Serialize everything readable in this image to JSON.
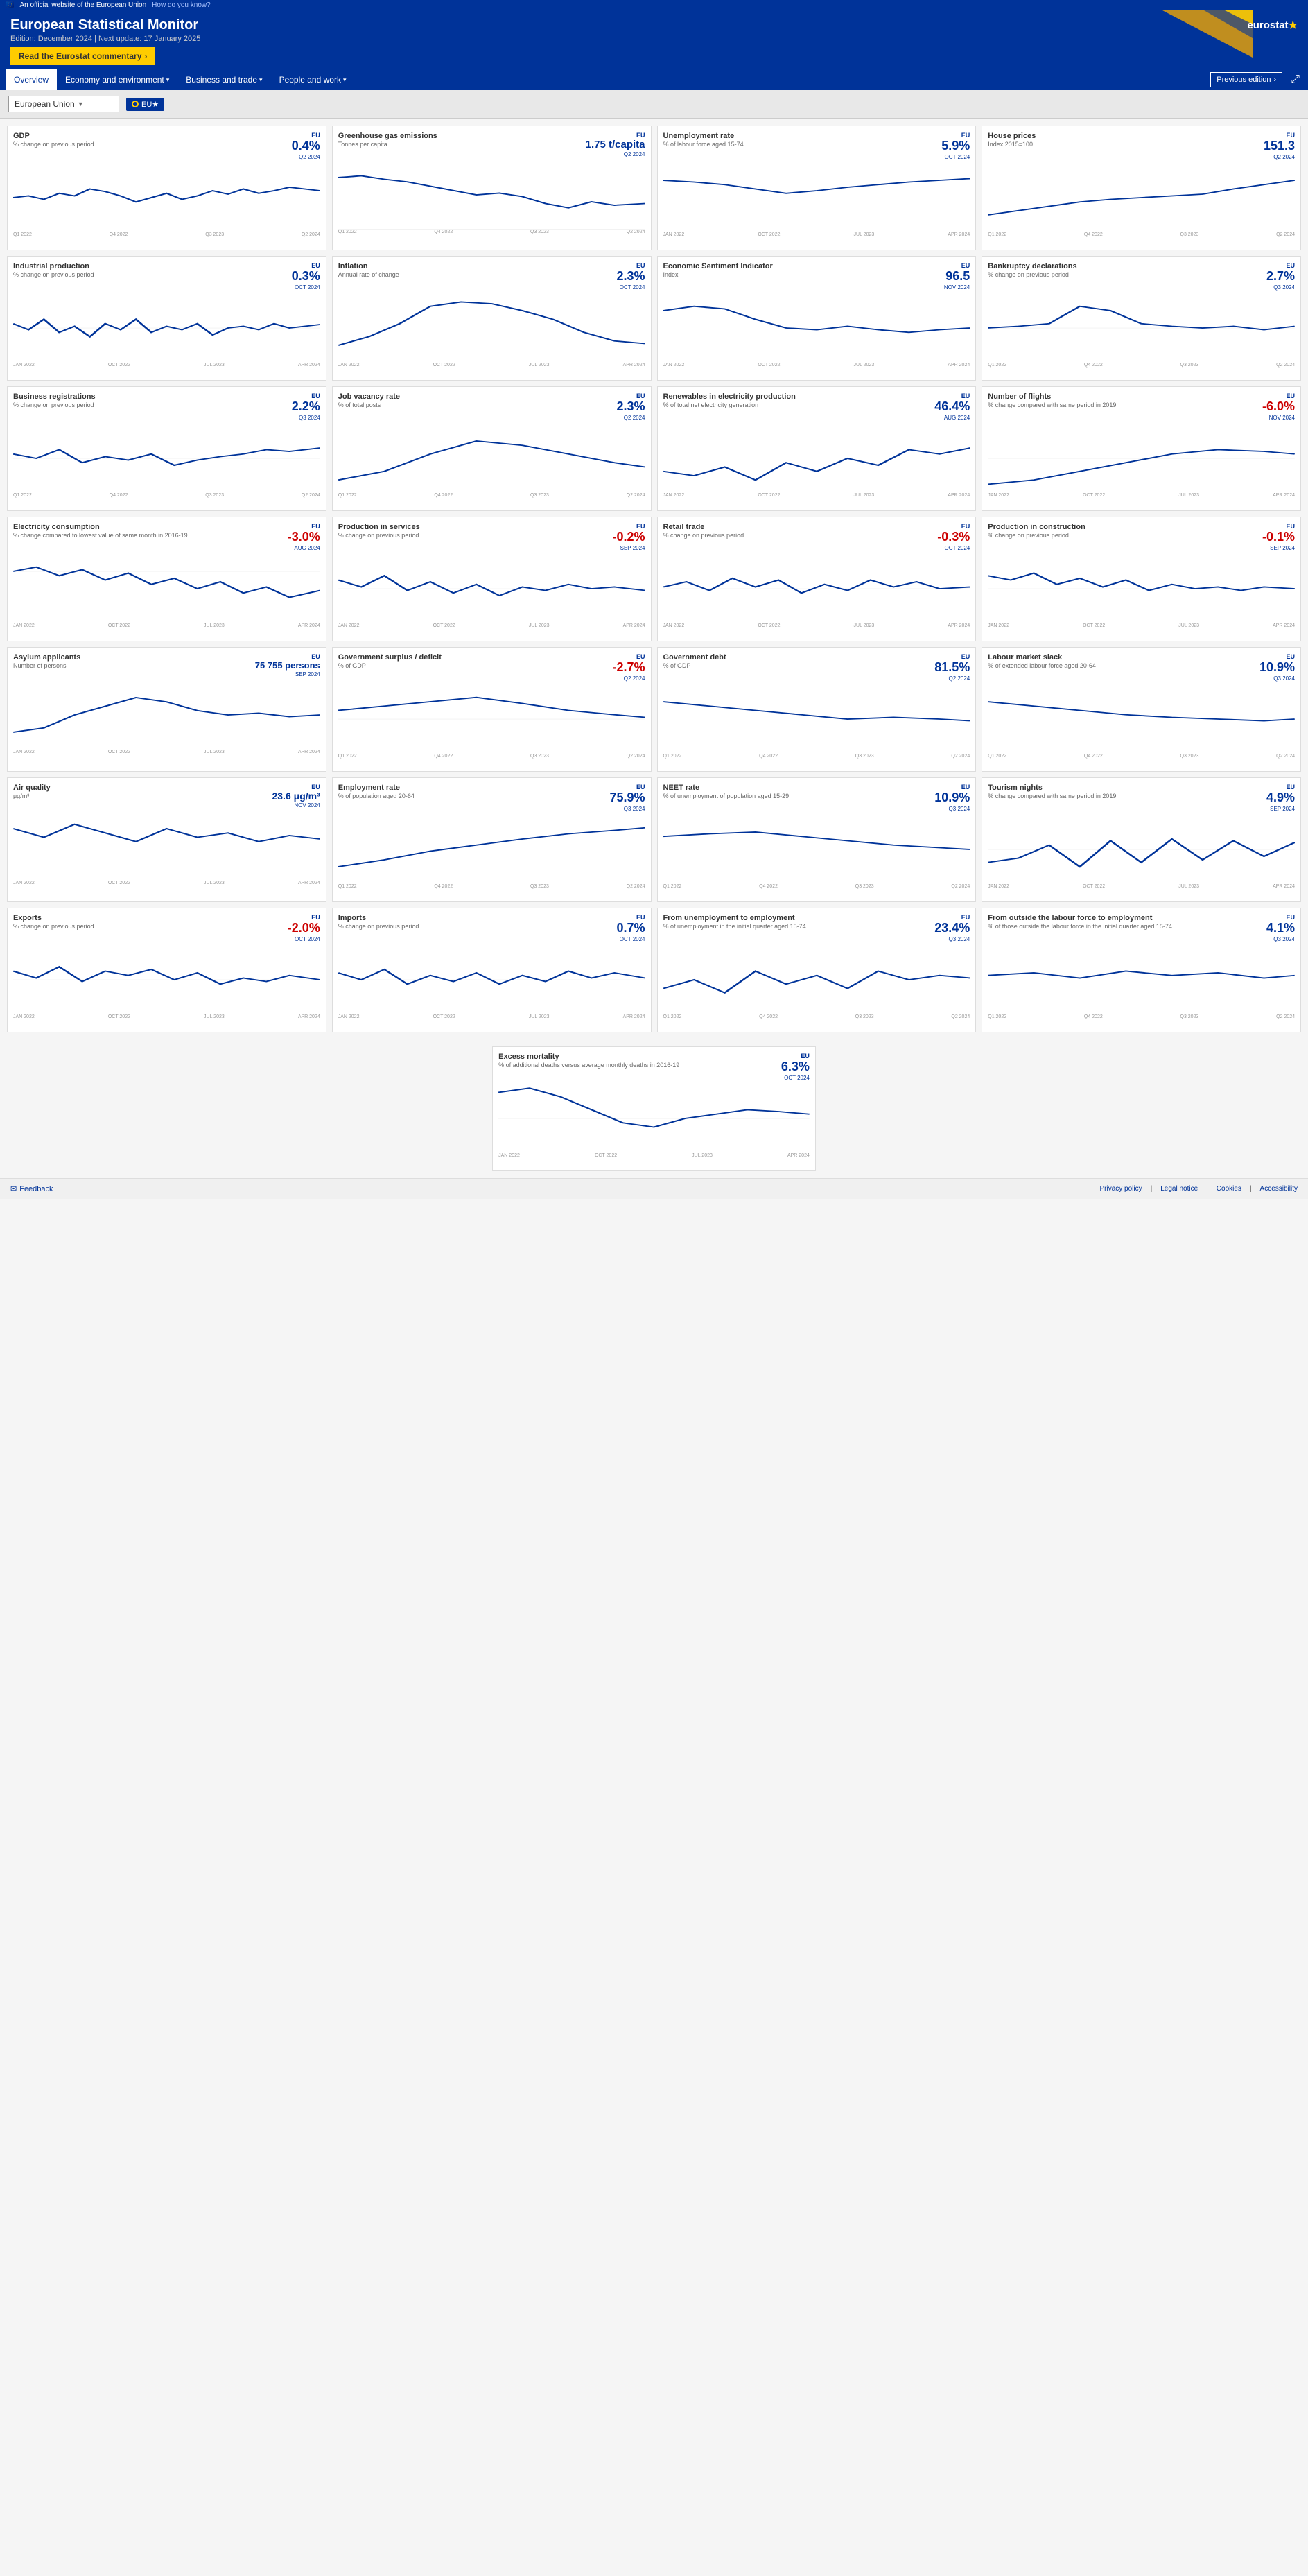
{
  "topbar": {
    "official_text": "An official website of the European Union",
    "how_link": "How do you know?"
  },
  "header": {
    "title": "European Statistical Monitor",
    "edition": "Edition: December 2024 | Next update: 17 January 2025",
    "commentary_btn": "Read the Eurostat commentary",
    "commentary_arrow": "›",
    "logo": "eurostat ★"
  },
  "nav": {
    "items": [
      {
        "label": "Overview",
        "active": true
      },
      {
        "label": "Economy and environment",
        "active": false,
        "hasDropdown": true
      },
      {
        "label": "Business and trade",
        "active": false,
        "hasDropdown": true
      },
      {
        "label": "People and work",
        "active": false,
        "hasDropdown": true
      }
    ],
    "prev_edition": "Previous edition",
    "prev_arrow": "›",
    "share_icon": "share"
  },
  "filter": {
    "country": "European Union",
    "indicator": "EU★",
    "dropdown_arrow": "▼"
  },
  "cards": [
    {
      "id": "gdp",
      "title": "GDP",
      "subtitle": "% change on previous period",
      "eu_label": "EU",
      "value": "0.4%",
      "value_class": "positive",
      "date": "Q2 2024",
      "chart_type": "line"
    },
    {
      "id": "greenhouse",
      "title": "Greenhouse gas emissions",
      "subtitle": "Tonnes per capita",
      "eu_label": "EU",
      "value": "1.75 t/capita",
      "value_class": "positive",
      "date": "Q2 2024",
      "chart_type": "line"
    },
    {
      "id": "unemployment",
      "title": "Unemployment rate",
      "subtitle": "% of labour force aged 15-74",
      "eu_label": "EU",
      "value": "5.9%",
      "value_class": "positive",
      "date": "OCT 2024",
      "chart_type": "line"
    },
    {
      "id": "houseprices",
      "title": "House prices",
      "subtitle": "Index 2015=100",
      "eu_label": "EU",
      "value": "151.3",
      "value_class": "positive",
      "date": "Q2 2024",
      "chart_type": "line"
    },
    {
      "id": "industrial",
      "title": "Industrial production",
      "subtitle": "% change on previous period",
      "eu_label": "EU",
      "value": "0.3%",
      "value_class": "positive",
      "date": "OCT 2024",
      "chart_type": "line"
    },
    {
      "id": "inflation",
      "title": "Inflation",
      "subtitle": "Annual rate of change",
      "eu_label": "EU",
      "value": "2.3%",
      "value_class": "positive",
      "date": "OCT 2024",
      "chart_type": "line"
    },
    {
      "id": "sentiment",
      "title": "Economic Sentiment Indicator",
      "subtitle": "Index",
      "eu_label": "EU",
      "value": "96.5",
      "value_class": "positive",
      "date": "NOV 2024",
      "chart_type": "line"
    },
    {
      "id": "bankruptcy",
      "title": "Bankruptcy declarations",
      "subtitle": "% change on previous period",
      "eu_label": "EU",
      "value": "2.7%",
      "value_class": "positive",
      "date": "Q3 2024",
      "chart_type": "line"
    },
    {
      "id": "business_reg",
      "title": "Business registrations",
      "subtitle": "% change on previous period",
      "eu_label": "EU",
      "value": "2.2%",
      "value_class": "positive",
      "date": "Q3 2024",
      "chart_type": "line"
    },
    {
      "id": "job_vacancy",
      "title": "Job vacancy rate",
      "subtitle": "% of total posts",
      "eu_label": "EU",
      "value": "2.3%",
      "value_class": "positive",
      "date": "Q2 2024",
      "chart_type": "line"
    },
    {
      "id": "renewables",
      "title": "Renewables in electricity production",
      "subtitle": "% of total net electricity generation",
      "eu_label": "EU",
      "value": "46.4%",
      "value_class": "positive",
      "date": "AUG 2024",
      "chart_type": "line"
    },
    {
      "id": "flights",
      "title": "Number of flights",
      "subtitle": "% change compared with same period in 2019",
      "eu_label": "EU",
      "value": "-6.0%",
      "value_class": "negative",
      "date": "NOV 2024",
      "chart_type": "line"
    },
    {
      "id": "electricity",
      "title": "Electricity consumption",
      "subtitle": "% change compared to lowest value of same month in 2016-19",
      "eu_label": "EU",
      "value": "-3.0%",
      "value_class": "negative",
      "date": "AUG 2024",
      "chart_type": "line"
    },
    {
      "id": "prod_services",
      "title": "Production in services",
      "subtitle": "% change on previous period",
      "eu_label": "EU",
      "value": "-0.2%",
      "value_class": "negative",
      "date": "SEP 2024",
      "chart_type": "line"
    },
    {
      "id": "retail",
      "title": "Retail trade",
      "subtitle": "% change on previous period",
      "eu_label": "EU",
      "value": "-0.3%",
      "value_class": "negative",
      "date": "OCT 2024",
      "chart_type": "line"
    },
    {
      "id": "prod_construction",
      "title": "Production in construction",
      "subtitle": "% change on previous period",
      "eu_label": "EU",
      "value": "-0.1%",
      "value_class": "negative",
      "date": "SEP 2024",
      "chart_type": "line"
    },
    {
      "id": "asylum",
      "title": "Asylum applicants",
      "subtitle": "Number of persons",
      "eu_label": "EU",
      "value": "75 755 persons",
      "value_class": "positive",
      "date": "SEP 2024",
      "chart_type": "line"
    },
    {
      "id": "gov_surplus",
      "title": "Government surplus / deficit",
      "subtitle": "% of GDP",
      "eu_label": "EU",
      "value": "-2.7%",
      "value_class": "negative",
      "date": "Q2 2024",
      "chart_type": "line"
    },
    {
      "id": "gov_debt",
      "title": "Government debt",
      "subtitle": "% of GDP",
      "eu_label": "EU",
      "value": "81.5%",
      "value_class": "positive",
      "date": "Q2 2024",
      "chart_type": "line"
    },
    {
      "id": "labour_slack",
      "title": "Labour market slack",
      "subtitle": "% of extended labour force aged 20-64",
      "eu_label": "EU",
      "value": "10.9%",
      "value_class": "positive",
      "date": "Q3 2024",
      "chart_type": "line"
    },
    {
      "id": "air_quality",
      "title": "Air quality",
      "subtitle": "μg/m³",
      "eu_label": "EU",
      "value": "23.6 μg/m³",
      "value_class": "positive",
      "date": "NOV 2024",
      "chart_type": "line"
    },
    {
      "id": "employment",
      "title": "Employment rate",
      "subtitle": "% of population aged 20-64",
      "eu_label": "EU",
      "value": "75.9%",
      "value_class": "positive",
      "date": "Q3 2024",
      "chart_type": "line"
    },
    {
      "id": "neet",
      "title": "NEET rate",
      "subtitle": "% of unemployment of population aged 15-29",
      "eu_label": "EU",
      "value": "10.9%",
      "value_class": "positive",
      "date": "Q3 2024",
      "chart_type": "line"
    },
    {
      "id": "tourism",
      "title": "Tourism nights",
      "subtitle": "% change compared with same period in 2019",
      "eu_label": "EU",
      "value": "4.9%",
      "value_class": "positive",
      "date": "SEP 2024",
      "chart_type": "line"
    },
    {
      "id": "exports",
      "title": "Exports",
      "subtitle": "% change on previous period",
      "eu_label": "EU",
      "value": "-2.0%",
      "value_class": "negative",
      "date": "OCT 2024",
      "chart_type": "line"
    },
    {
      "id": "imports",
      "title": "Imports",
      "subtitle": "% change on previous period",
      "eu_label": "EU",
      "value": "0.7%",
      "value_class": "positive",
      "date": "OCT 2024",
      "chart_type": "line"
    },
    {
      "id": "unemp_to_emp",
      "title": "From unemployment to employment",
      "subtitle": "% of unemployment in the initial quarter aged 15-74",
      "eu_label": "EU",
      "value": "23.4%",
      "value_class": "positive",
      "date": "Q3 2024",
      "chart_type": "line"
    },
    {
      "id": "outside_labour",
      "title": "From outside the labour force to employment",
      "subtitle": "% of those outside the labour force in the initial quarter aged 15-74",
      "eu_label": "EU",
      "value": "4.1%",
      "value_class": "positive",
      "date": "Q3 2024",
      "chart_type": "line"
    },
    {
      "id": "excess_mortality",
      "title": "Excess mortality",
      "subtitle": "% of additional deaths versus average monthly deaths in 2016-19",
      "eu_label": "EU",
      "value": "6.3%",
      "value_class": "positive",
      "date": "OCT 2024",
      "chart_type": "line"
    }
  ],
  "footer": {
    "feedback": "Feedback",
    "links": [
      "Privacy policy",
      "Legal notice",
      "Cookies",
      "Accessibility"
    ]
  }
}
